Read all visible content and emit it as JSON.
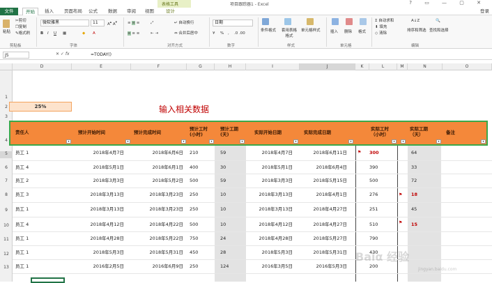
{
  "app": {
    "title": "项目跟踪器1 - Excel",
    "context_group": "表格工具",
    "window_controls": "? ▭ — ▢ ✕",
    "login": "登录"
  },
  "tabs": [
    "文件",
    "开始",
    "插入",
    "页面布局",
    "公式",
    "数据",
    "审阅",
    "视图",
    "设计"
  ],
  "ribbon": {
    "clipboard": {
      "paste": "粘贴",
      "cut": "剪切",
      "copy": "复制",
      "format_painter": "格式刷",
      "label": "剪贴板"
    },
    "font": {
      "name": "微软雅黑",
      "size": "11",
      "bold": "B",
      "italic": "I",
      "underline": "U",
      "label": "字体"
    },
    "alignment": {
      "wrap": "自动换行",
      "merge": "合并后居中",
      "label": "对齐方式"
    },
    "number": {
      "format": "日期",
      "percent": "%",
      "comma": ",",
      "label": "数字"
    },
    "styles": {
      "conditional": "条件格式",
      "table": "套用表格格式",
      "cell_styles": "单元格样式",
      "label": "样式"
    },
    "cells": {
      "insert": "插入",
      "delete": "删除",
      "format": "格式",
      "label": "单元格"
    },
    "editing": {
      "autosum": "自动求和",
      "fill": "填充",
      "clear": "清除",
      "sort": "排序和筛选",
      "find": "查找和选择",
      "label": "编辑"
    }
  },
  "formula_bar": {
    "name_box": "J5",
    "fx": "fx",
    "formula": "=TODAY()"
  },
  "columns": [
    "D",
    "E",
    "F",
    "G",
    "H",
    "I",
    "J",
    "K",
    "L",
    "M",
    "N",
    "O"
  ],
  "rows": [
    "1",
    "2",
    "3",
    "4",
    "5",
    "6",
    "7",
    "8",
    "9",
    "10",
    "11",
    "12",
    "13"
  ],
  "sheet": {
    "percent": "25%",
    "note": "输入相关数据",
    "headers": {
      "owner": "责任人",
      "plan_start": "预计开始时间",
      "plan_end": "预计完成时间",
      "plan_hours": "预计工时\n(小时)",
      "plan_days": "预计工期\n(天)",
      "act_start": "实际开始日期",
      "act_end": "实际完成日期",
      "act_hours": "实际工时\n（小时）",
      "act_days": "实际工期\n（天）",
      "remarks": "备注"
    },
    "data_rows": [
      {
        "owner": "员工 1",
        "ps": "2018年4月7日",
        "pe": "2018年6月6日",
        "ph": "210",
        "pd": "59",
        "as": "2018年4月7日",
        "ae": "2018年6月11日",
        "ah": "300",
        "ad": "64",
        "ah_red": true,
        "ad_red": false
      },
      {
        "owner": "员工 4",
        "ps": "2018年5月1日",
        "pe": "2018年6月1日",
        "ph": "400",
        "pd": "30",
        "as": "2018年5月1日",
        "ae": "2018年6月4日",
        "ah": "390",
        "ad": "33",
        "ah_red": false,
        "ad_red": false
      },
      {
        "owner": "员工 2",
        "ps": "2018年3月3日",
        "pe": "2018年5月2日",
        "ph": "500",
        "pd": "59",
        "as": "2018年3月3日",
        "ae": "2018年5月15日",
        "ah": "500",
        "ad": "72",
        "ah_red": false,
        "ad_red": false
      },
      {
        "owner": "员工 3",
        "ps": "2018年3月13日",
        "pe": "2018年3月23日",
        "ph": "250",
        "pd": "10",
        "as": "2018年3月13日",
        "ae": "2018年4月1日",
        "ah": "276",
        "ad": "18",
        "ah_red": false,
        "ad_red": true
      },
      {
        "owner": "员工 1",
        "ps": "2018年3月13日",
        "pe": "2018年3月23日",
        "ph": "250",
        "pd": "10",
        "as": "2018年3月13日",
        "ae": "2018年4月27日",
        "ah": "251",
        "ad": "45",
        "ah_red": false,
        "ad_red": false
      },
      {
        "owner": "员工 4",
        "ps": "2018年4月12日",
        "pe": "2018年4月22日",
        "ph": "500",
        "pd": "10",
        "as": "2018年4月12日",
        "ae": "2018年4月27日",
        "ah": "510",
        "ad": "15",
        "ah_red": false,
        "ad_red": true
      },
      {
        "owner": "员工 1",
        "ps": "2018年4月28日",
        "pe": "2018年5月22日",
        "ph": "750",
        "pd": "24",
        "as": "2018年4月28日",
        "ae": "2018年5月27日",
        "ah": "790",
        "ad": "",
        "ah_red": false,
        "ad_red": false
      },
      {
        "owner": "员工 1",
        "ps": "2018年5月3日",
        "pe": "2018年5月31日",
        "ph": "450",
        "pd": "28",
        "as": "2018年5月3日",
        "ae": "2018年5月31日",
        "ah": "430",
        "ad": "",
        "ah_red": false,
        "ad_red": false
      },
      {
        "owner": "员工 1",
        "ps": "2016年2月5日",
        "pe": "2016年6月9日",
        "ph": "250",
        "pd": "124",
        "as": "2016年3月5日",
        "ae": "2016年5月3日",
        "ah": "200",
        "ad": "",
        "ah_red": false,
        "ad_red": false
      }
    ]
  },
  "watermark": {
    "brand": "Baiα 经验",
    "url": "jingyan.baidu.com"
  },
  "colors": {
    "excel_green": "#217346",
    "header_orange": "#f4883a",
    "header_border": "#3aa84a",
    "warn_red": "#c00000"
  }
}
